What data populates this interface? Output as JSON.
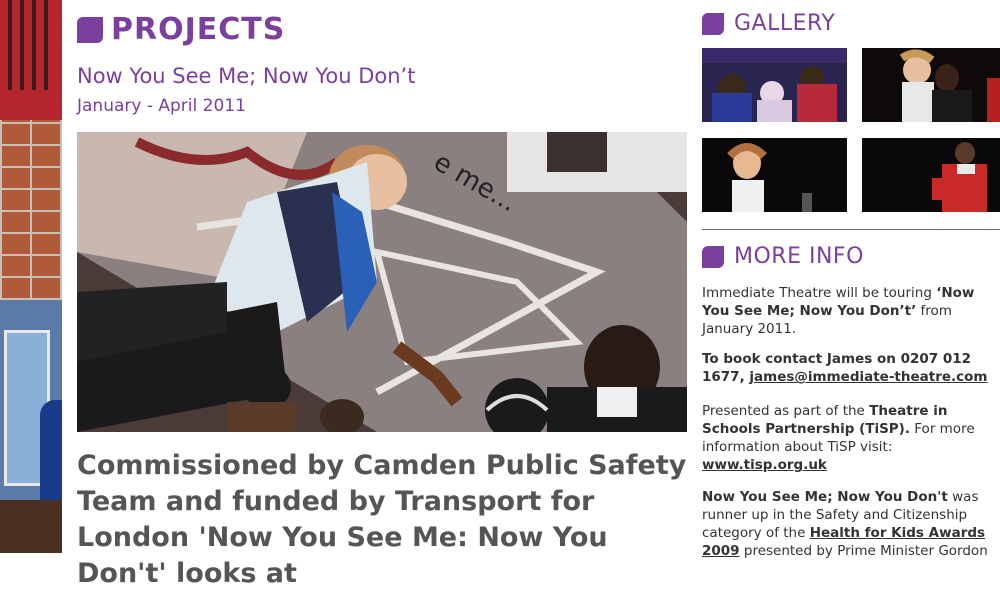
{
  "projects": {
    "heading": "PROJECTS"
  },
  "project": {
    "name": "Now You See Me; Now You Don’t",
    "dates": "January - April 2011",
    "lead": "Commissioned by Camden Public Safety Team and funded by Transport for London 'Now You See Me: Now You Don't' looks at"
  },
  "gallery": {
    "heading": "GALLERY"
  },
  "more_info": {
    "heading": "MORE INFO",
    "p1_pre": "Immediate Theatre will be touring ",
    "p1_bold": "‘Now You See Me; Now You Don’t’",
    "p1_post": " from January 2011.",
    "p2_bold": "To book contact James on 0207 012 1677, ",
    "p2_link": "james@immediate-theatre.com",
    "p3_pre": "Presented as part of the ",
    "p3_bold": "Theatre in Schools Partnership (TiSP).",
    "p3_mid": " For more information about TiSP visit: ",
    "p3_link": "www.tisp.org.uk",
    "p4_bold": "Now You See Me; Now You Don't",
    "p4_mid": " was runner up in the Safety and Citizenship category of the ",
    "p4_link": "Health for Kids Awards 2009",
    "p4_post": " presented by Prime Minister Gordon"
  },
  "colors": {
    "accent": "#7b3f9e",
    "text": "#333333",
    "lead_text": "#555555"
  },
  "icons": {
    "section_marker": "rounded-square-tab-icon"
  }
}
